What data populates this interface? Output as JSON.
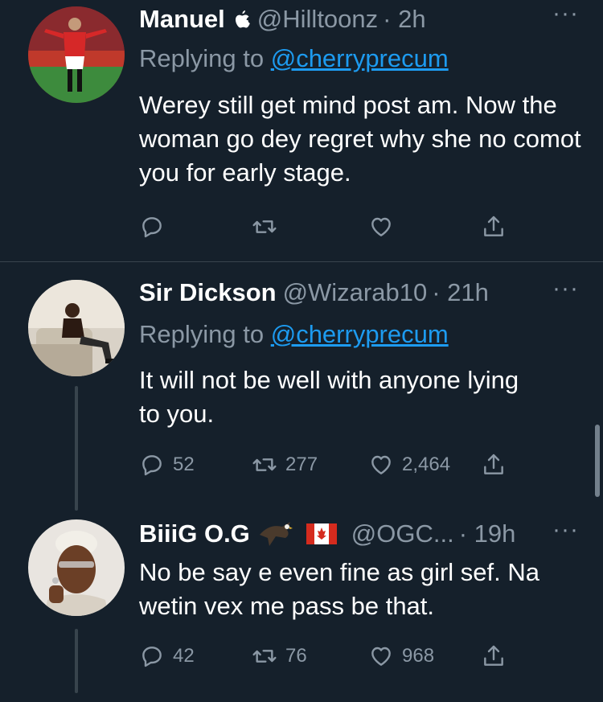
{
  "tweets": [
    {
      "name": "Manuel",
      "badge": "apple-logo-icon",
      "handle": "@Hilltoonz",
      "time": "· 2h",
      "reply_prefix": "Replying to",
      "reply_to": "@cherryprecum",
      "text": "Werey still get mind post am. Now the woman go dey regret why she no comot you for early stage.",
      "counts": {
        "reply": "",
        "retweet": "",
        "like": ""
      }
    },
    {
      "name": "Sir Dickson",
      "handle": "@Wizarab10",
      "time": "· 21h",
      "reply_prefix": "Replying to",
      "reply_to": "@cherryprecum",
      "text": "It will not be well with anyone lying to you.",
      "counts": {
        "reply": "52",
        "retweet": "277",
        "like": "2,464"
      }
    },
    {
      "name": "BiiiG O.G",
      "badges": [
        "eagle-emoji",
        "canada-flag-emoji"
      ],
      "handle": "@OGC...",
      "time": "· 19h",
      "text": "No be say e even fine as girl sef. Na wetin vex me pass be that.",
      "counts": {
        "reply": "42",
        "retweet": "76",
        "like": "968"
      }
    }
  ],
  "more_label": "···",
  "colors": {
    "background": "#15202b",
    "secondary": "#8b98a5",
    "link": "#1d9bf0",
    "divider": "#38444d"
  }
}
